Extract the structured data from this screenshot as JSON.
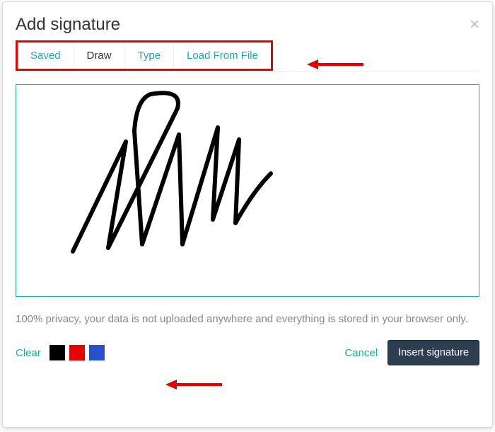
{
  "header": {
    "title": "Add signature"
  },
  "tabs": {
    "saved": "Saved",
    "draw": "Draw",
    "type": "Type",
    "load": "Load From File",
    "active": "draw"
  },
  "privacy_text": "100% privacy, your data is not uploaded anywhere and everything is stored in your browser only.",
  "footer": {
    "clear": "Clear",
    "cancel": "Cancel",
    "insert": "Insert signature"
  },
  "colors": {
    "accent_teal": "#1aae9f",
    "highlight_red": "#e60000",
    "insert_bg": "#2d3e50",
    "swatches": [
      "#000000",
      "#e60000",
      "#2850c8"
    ]
  },
  "annotations": {
    "arrow_tabs": true,
    "arrow_footer": true
  }
}
